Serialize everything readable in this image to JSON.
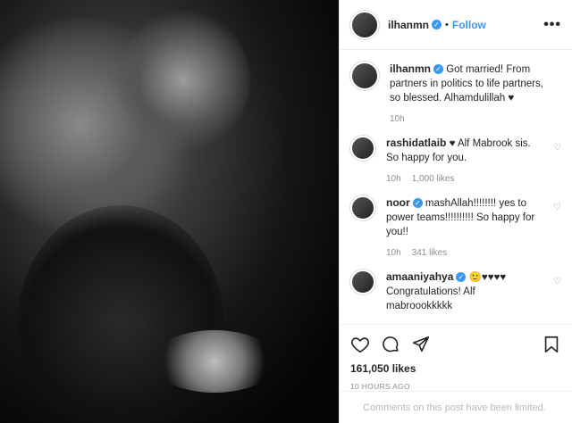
{
  "header": {
    "username": "ilhanmn",
    "follow_label": "Follow",
    "separator": "•",
    "more_label": "•••"
  },
  "caption": {
    "username": "ilhanmn",
    "text": "Got married! From partners in politics to life partners, so blessed. Alhamdulillah ♥",
    "time": "10h"
  },
  "comments": [
    {
      "username": "rashidatlaib",
      "verified": false,
      "text": "♥ Alf Mabrook sis. So happy for you.",
      "time": "10h",
      "likes": "1,000 likes"
    },
    {
      "username": "noor",
      "verified": true,
      "text": "mashAllah!!!!!!!! yes to power teams!!!!!!!!!! So happy for you!!",
      "time": "10h",
      "likes": "341 likes"
    },
    {
      "username": "amaaniyahya",
      "verified": true,
      "text": "🙂♥♥♥♥ Congratulations! Alf mabroookkkkk",
      "time": "",
      "likes": ""
    }
  ],
  "actions": {
    "likes": "161,050 likes",
    "ago": "10 HOURS AGO"
  },
  "footer": {
    "limited_text": "Comments on this post have been limited."
  },
  "icons": {
    "like": "heart-icon",
    "comment": "comment-icon",
    "share": "share-icon",
    "save": "bookmark-icon"
  },
  "colors": {
    "accent": "#3897f0",
    "muted": "#8e8e8e"
  }
}
